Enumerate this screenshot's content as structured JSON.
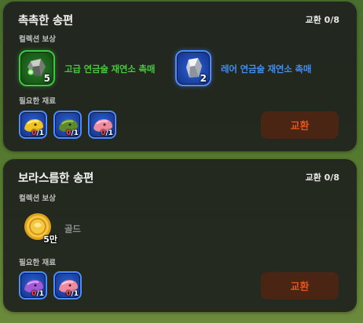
{
  "cards": [
    {
      "title": "촉촉한 송편",
      "exchange_count": "교환 0/8",
      "reward_label": "컬렉션 보상",
      "rewards": [
        {
          "name": "고급 연금술 재연소 촉매",
          "count": "5",
          "icon": "green-crystal-icon",
          "grade_color": "#48c63f"
        },
        {
          "name": "레어 연금술 재연소 촉매",
          "count": "2",
          "icon": "silver-crystal-icon",
          "grade_color": "#3f8cf2"
        }
      ],
      "material_label": "필요한 재료",
      "materials": [
        {
          "icon": "yellow-songpyeon-icon",
          "have": "0",
          "need": "/1"
        },
        {
          "icon": "green-songpyeon-icon",
          "have": "0",
          "need": "/1"
        },
        {
          "icon": "pink-songpyeon-icon",
          "have": "0",
          "need": "/1"
        }
      ],
      "button_label": "교환"
    },
    {
      "title": "보라스름한 송편",
      "exchange_count": "교환 0/8",
      "reward_label": "컬렉션 보상",
      "rewards": [
        {
          "name": "골드",
          "count": "5만",
          "icon": "gold-coin-icon"
        }
      ],
      "material_label": "필요한 재료",
      "materials": [
        {
          "icon": "purple-songpyeon-icon",
          "have": "0",
          "need": "/1"
        },
        {
          "icon": "pink-songpyeon-icon",
          "have": "0",
          "need": "/1"
        }
      ],
      "button_label": "교환"
    }
  ],
  "colors": {
    "button_bg": "#4a2514",
    "button_text": "#e0541e",
    "count_zero": "#ff4a4a"
  }
}
